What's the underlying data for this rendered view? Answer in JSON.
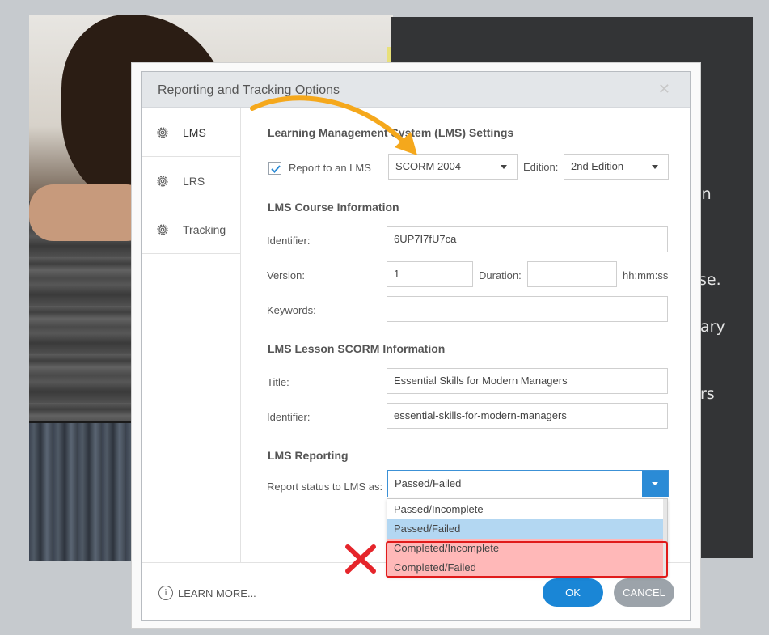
{
  "background_slide": {
    "lines": [
      "on",
      "se.",
      "ary",
      "rs"
    ]
  },
  "dialog": {
    "title": "Reporting and Tracking Options",
    "close_icon": "close-icon"
  },
  "sidebar": {
    "items": [
      {
        "label": "LMS",
        "icon": "gear-icon"
      },
      {
        "label": "LRS",
        "icon": "gear-icon"
      },
      {
        "label": "Tracking",
        "icon": "gear-icon"
      }
    ]
  },
  "lms_settings": {
    "heading": "Learning Management System (LMS) Settings",
    "report_checkbox_label": "Report to an LMS",
    "report_checked": true,
    "standard_value": "SCORM 2004",
    "edition_label": "Edition:",
    "edition_value": "2nd Edition"
  },
  "course_info": {
    "heading": "LMS Course Information",
    "identifier_label": "Identifier:",
    "identifier_value": "6UP7I7fU7ca",
    "version_label": "Version:",
    "version_value": "1",
    "duration_label": "Duration:",
    "duration_value": "",
    "duration_unit": "hh:mm:ss",
    "keywords_label": "Keywords:",
    "keywords_value": ""
  },
  "lesson_info": {
    "heading": "LMS Lesson SCORM Information",
    "title_label": "Title:",
    "title_value": "Essential Skills for Modern Managers",
    "identifier_label": "Identifier:",
    "identifier_value": "essential-skills-for-modern-managers"
  },
  "reporting": {
    "heading": "LMS Reporting",
    "status_label": "Report status to LMS as:",
    "status_value": "Passed/Failed",
    "options": [
      "Passed/Incomplete",
      "Passed/Failed",
      "Completed/Incomplete",
      "Completed/Failed"
    ],
    "selected_option": "Passed/Failed"
  },
  "footer": {
    "learn_more": "LEARN MORE...",
    "ok": "OK",
    "cancel": "CANCEL"
  },
  "annotations": {
    "arrow_color": "#f5a81c",
    "cross_color": "#e5252b",
    "highlight_color": "#e01b1b"
  }
}
